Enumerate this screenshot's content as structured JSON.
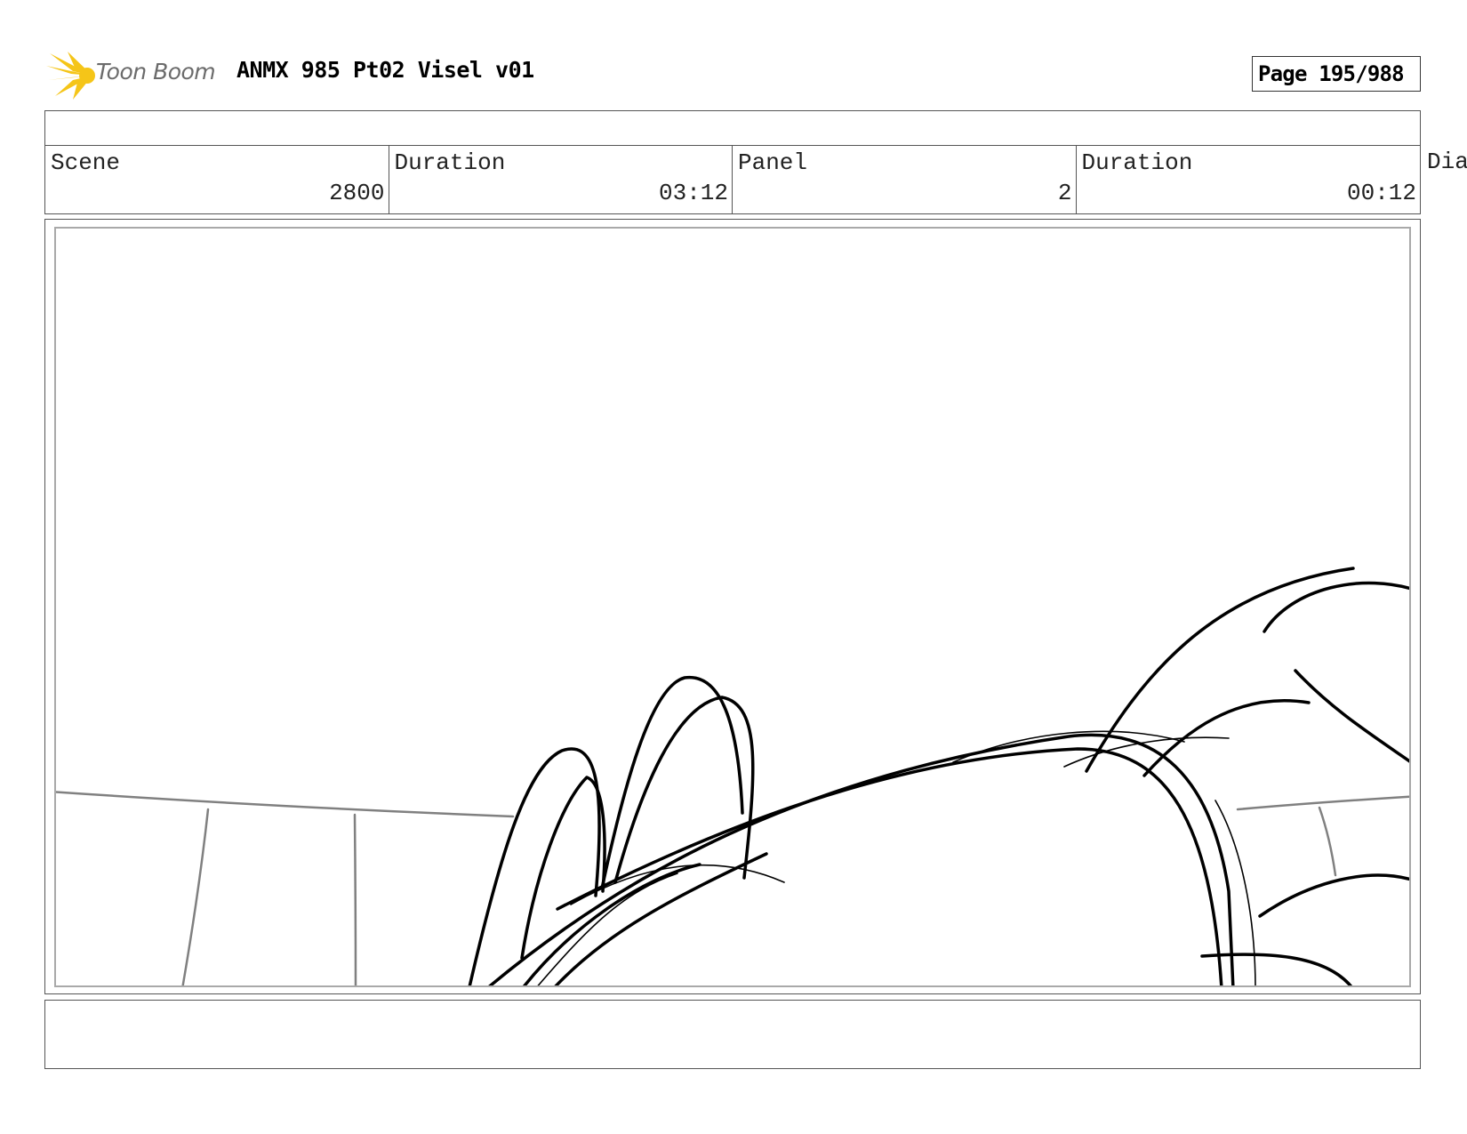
{
  "header": {
    "logo_text": "Toon Boom",
    "title": "ANMX 985 Pt02 Visel v01",
    "page_label": "Page 195/988"
  },
  "info": {
    "scene_label": "Scene",
    "scene_value": "2800",
    "scene_duration_label": "Duration",
    "scene_duration_value": "03:12",
    "panel_label": "Panel",
    "panel_value": "2",
    "panel_duration_label": "Duration",
    "panel_duration_value": "00:12",
    "dialogue_label_partial": "Dia"
  },
  "colors": {
    "logo_ray": "#f5c518",
    "logo_text": "#6b6b6b",
    "frame_border": "#555555",
    "art_border": "#a9a9a9",
    "sketch_line": "#000000",
    "background_line": "#808080"
  }
}
